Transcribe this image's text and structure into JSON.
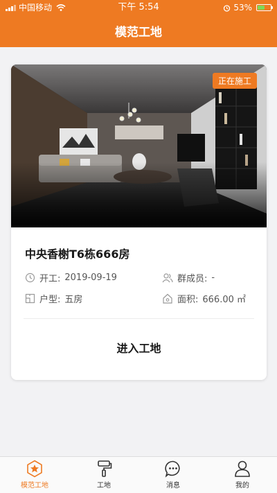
{
  "status_bar": {
    "carrier": "中国移动",
    "time": "下午 5:54",
    "battery_percent_label": "53%",
    "battery_level": 0.53
  },
  "nav": {
    "title": "模范工地"
  },
  "card": {
    "status_badge": "正在施工",
    "title": "中央香榭T6栋666房",
    "start_label": "开工:",
    "start_date": "2019-09-19",
    "group_label": "群成员:",
    "group_value": "-",
    "layout_label": "户型:",
    "layout_value": "五房",
    "area_label": "面积:",
    "area_value": "666.00 ㎡",
    "enter_button": "进入工地"
  },
  "tabs": [
    {
      "label": "模范工地",
      "icon": "star-icon",
      "active": true
    },
    {
      "label": "工地",
      "icon": "paint-roller-icon",
      "active": false
    },
    {
      "label": "消息",
      "icon": "chat-icon",
      "active": false
    },
    {
      "label": "我的",
      "icon": "user-icon",
      "active": false
    }
  ],
  "colors": {
    "accent": "#ee7a22",
    "battery": "#7ed957"
  }
}
